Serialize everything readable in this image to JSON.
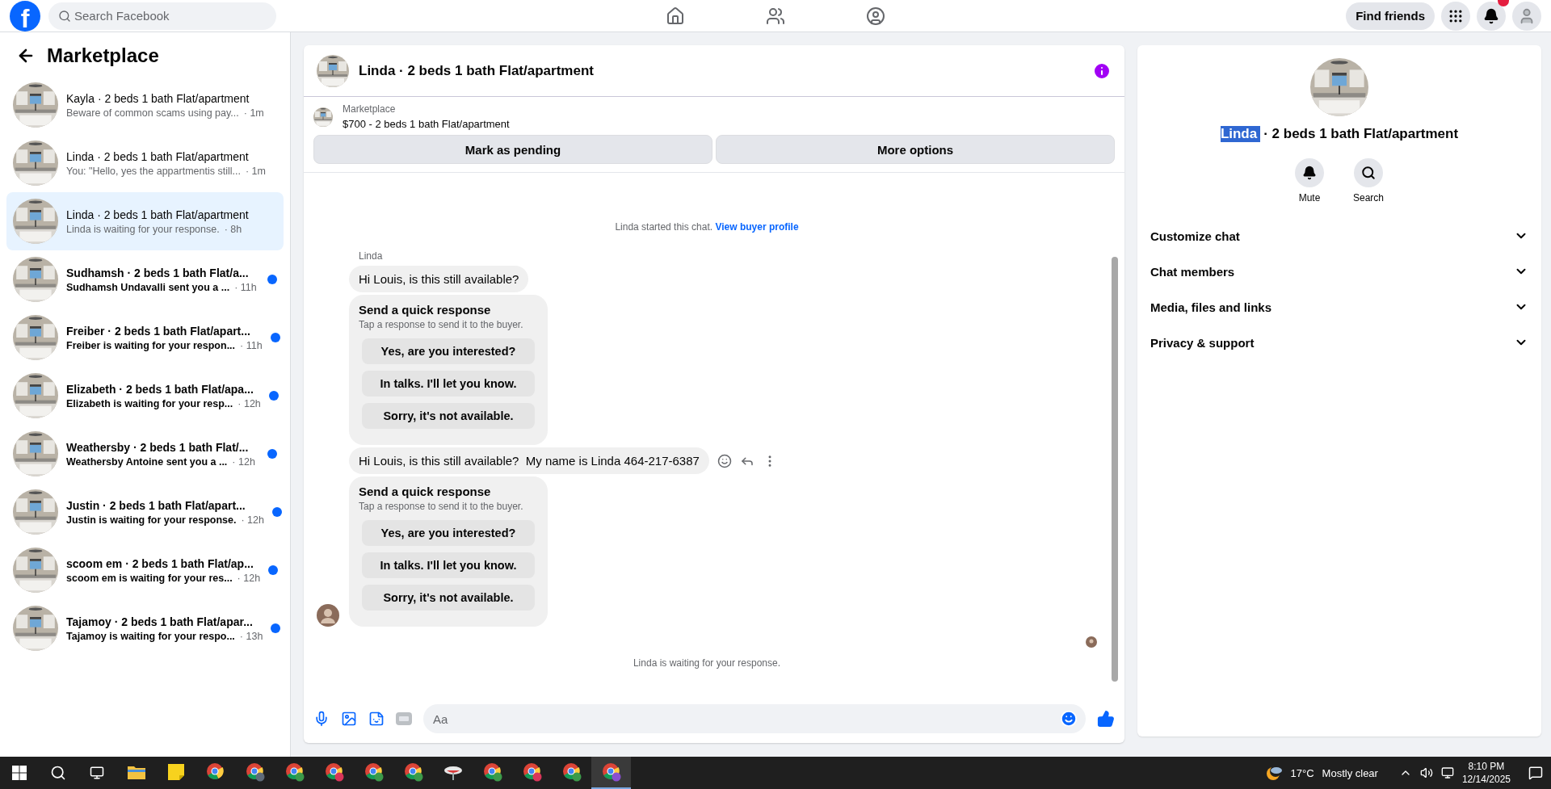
{
  "top_bar": {
    "logo": "f",
    "search": {
      "placeholder": "Search Facebook"
    },
    "find_friends": "Find friends"
  },
  "sidebar": {
    "title": "Marketplace",
    "conversations": [
      {
        "title": "Kayla · 2 beds 1 bath Flat/apartment",
        "preview": "Beware of common scams using pay...",
        "time": "· 1m",
        "unread": false,
        "selected": false
      },
      {
        "title": "Linda · 2 beds 1 bath Flat/apartment",
        "preview": "You: \"Hello, yes the appartmentis still...",
        "time": "· 1m",
        "unread": false,
        "selected": false
      },
      {
        "title": "Linda · 2 beds 1 bath Flat/apartment",
        "preview": "Linda is waiting for your response.",
        "time": "· 8h",
        "unread": false,
        "selected": true
      },
      {
        "title": "Sudhamsh · 2 beds 1 bath Flat/a...",
        "preview": "Sudhamsh Undavalli sent you a ...",
        "time": "· 11h",
        "unread": true,
        "selected": false
      },
      {
        "title": "Freiber · 2 beds 1 bath Flat/apart...",
        "preview": "Freiber is waiting for your respon...",
        "time": "· 11h",
        "unread": true,
        "selected": false
      },
      {
        "title": "Elizabeth · 2 beds 1 bath Flat/apa...",
        "preview": "Elizabeth is waiting for your resp...",
        "time": "· 12h",
        "unread": true,
        "selected": false
      },
      {
        "title": "Weathersby · 2 beds 1 bath Flat/...",
        "preview": "Weathersby Antoine sent you a ...",
        "time": "· 12h",
        "unread": true,
        "selected": false
      },
      {
        "title": "Justin · 2 beds 1 bath Flat/apart...",
        "preview": "Justin is waiting for your response.",
        "time": "· 12h",
        "unread": true,
        "selected": false
      },
      {
        "title": "scoom em · 2 beds 1 bath Flat/ap...",
        "preview": "scoom em is waiting for your res...",
        "time": "· 12h",
        "unread": true,
        "selected": false
      },
      {
        "title": "Tajamoy · 2 beds 1 bath Flat/apar...",
        "preview": "Tajamoy is waiting for your respo...",
        "time": "· 13h",
        "unread": true,
        "selected": false
      }
    ]
  },
  "chat": {
    "title": "Linda · 2 beds 1 bath Flat/apartment",
    "listing": {
      "label": "Marketplace",
      "title": "$700 - 2 beds 1 bath Flat/apartment"
    },
    "actions": [
      "Mark as pending",
      "More options"
    ],
    "started": {
      "text": "Linda started this chat.",
      "link": "View buyer profile"
    },
    "messages": [
      {
        "kind": "sender",
        "text": "Linda"
      },
      {
        "kind": "bubble",
        "text": "Hi Louis, is this still available?",
        "show_actions": false
      },
      {
        "kind": "quick_response",
        "title": "Send a quick response",
        "subtitle": "Tap a response to send it to the buyer.",
        "options": [
          "Yes, are you interested?",
          "In talks. I'll let you know.",
          "Sorry, it's not available."
        ]
      },
      {
        "kind": "bubble",
        "text": "Hi Louis, is this still available?  My name is Linda 464-217-6387",
        "show_actions": true
      },
      {
        "kind": "quick_response",
        "title": "Send a quick response",
        "subtitle": "Tap a response to send it to the buyer.",
        "options": [
          "Yes, are you interested?",
          "In talks. I'll let you know.",
          "Sorry, it's not available."
        ]
      }
    ],
    "status": "Linda is waiting for your response.",
    "composer": {
      "placeholder": "Aa"
    }
  },
  "details": {
    "name": "Linda",
    "name_selected": true,
    "title_rest": "· 2 beds 1 bath Flat/apartment",
    "actions": [
      {
        "kind": "mute",
        "label": "Mute"
      },
      {
        "kind": "search",
        "label": "Search"
      }
    ],
    "sections": [
      {
        "label": "Customize chat",
        "expanded": false
      },
      {
        "label": "Chat members",
        "expanded": false
      },
      {
        "label": "Media, files and links",
        "expanded": false
      },
      {
        "label": "Privacy & support",
        "expanded": false
      }
    ]
  },
  "taskbar": {
    "apps": [
      {
        "kind": "explorer",
        "selected": false
      },
      {
        "kind": "notes",
        "selected": false
      },
      {
        "kind": "chrome",
        "selected": false
      },
      {
        "kind": "chrome",
        "color": "#5f6b7a",
        "selected": false
      },
      {
        "kind": "chrome",
        "color": "#3c9a4a",
        "selected": false
      },
      {
        "kind": "chrome",
        "color": "#d9365a",
        "selected": false
      },
      {
        "kind": "chrome",
        "color": "#3c9a4a",
        "selected": false
      },
      {
        "kind": "chrome",
        "color": "#3c9a4a",
        "selected": false
      },
      {
        "kind": "remote",
        "selected": false
      },
      {
        "kind": "chrome",
        "color": "#3c9a4a",
        "selected": false
      },
      {
        "kind": "chrome",
        "color": "#d9365a",
        "selected": false
      },
      {
        "kind": "chrome",
        "color": "#3c9a4a",
        "selected": false
      },
      {
        "kind": "chrome",
        "color": "#8a4fd0",
        "selected": true
      }
    ],
    "weather": {
      "temp": "17°C",
      "condition": "Mostly clear"
    },
    "clock": {
      "time": "8:10 PM",
      "date": "12/14/2025"
    }
  }
}
